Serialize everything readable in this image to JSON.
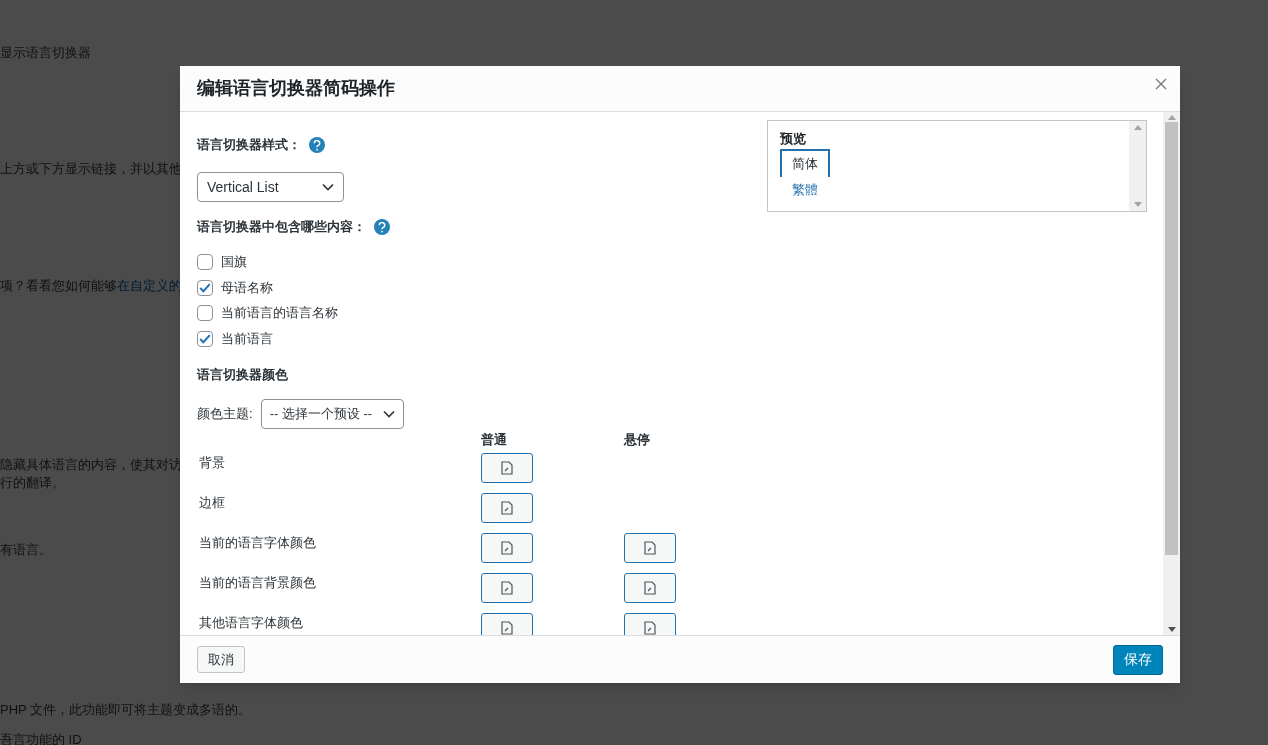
{
  "background_page": {
    "lines": [
      {
        "text": "显示语言切换器"
      },
      {
        "text": "上方或下方显示链接，并以其他"
      },
      {
        "text": "项？看看您如何能够",
        "link": "在自定义的"
      },
      {
        "text": "隐藏具体语言的内容，使其对访"
      },
      {
        "text": "行的翻译。"
      },
      {
        "text": "有语言。"
      },
      {
        "text": "PHP 文件，此功能即可将主题变成多语的。"
      },
      {
        "text": "吾言功能的 ID"
      }
    ]
  },
  "dialog": {
    "title": "编辑语言切换器简码操作",
    "style_label": "语言切换器样式：",
    "style_select": {
      "value": "Vertical List"
    },
    "content_label": "语言切换器中包含哪些内容：",
    "options": [
      {
        "label": "国旗",
        "checked": false
      },
      {
        "label": "母语名称",
        "checked": true
      },
      {
        "label": "当前语言的语言名称",
        "checked": false
      },
      {
        "label": "当前语言",
        "checked": true
      }
    ],
    "colors_heading": "语言切换器颜色",
    "theme_label": "颜色主题:",
    "theme_select": {
      "value": "-- 选择一个预设 --"
    },
    "color_columns": [
      "普通",
      "悬停"
    ],
    "color_rows": [
      {
        "label": "背景",
        "normal": true,
        "hover": false
      },
      {
        "label": "边框",
        "normal": true,
        "hover": false
      },
      {
        "label": "当前的语言字体颜色",
        "normal": true,
        "hover": true
      },
      {
        "label": "当前的语言背景颜色",
        "normal": true,
        "hover": true
      },
      {
        "label": "其他语言字体颜色",
        "normal": true,
        "hover": true
      }
    ],
    "preview": {
      "title": "预览",
      "items": [
        {
          "label": "简体",
          "selected": true
        },
        {
          "label": "繁體",
          "selected": false
        }
      ]
    },
    "buttons": {
      "cancel": "取消",
      "save": "保存"
    }
  }
}
